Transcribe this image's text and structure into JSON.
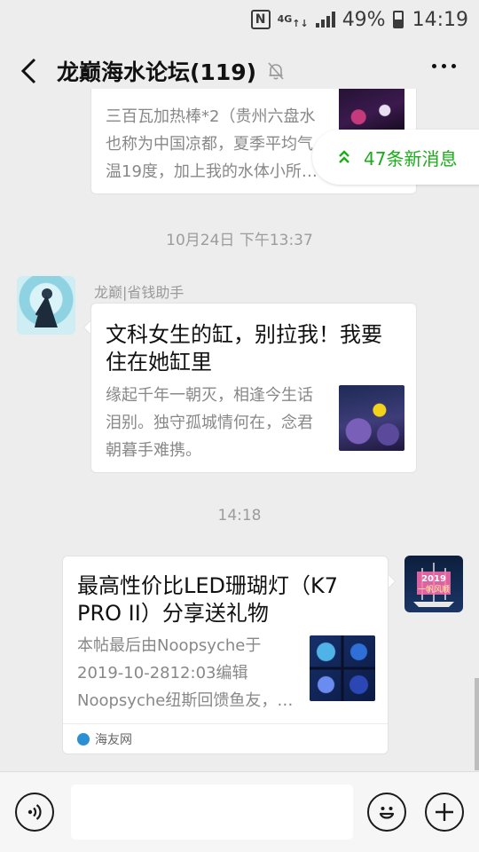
{
  "status_bar": {
    "nfc": "N",
    "network": "4G",
    "battery": "49%",
    "time": "14:19"
  },
  "header": {
    "title": "龙巅海水论坛(119)"
  },
  "new_messages_pill": "47条新消息",
  "messages": [
    {
      "type": "link_card",
      "desc": "三百瓦加热棒*2（贵州六盘水也称为中国凉都，夏季平均气温19度，加上我的水体小所…"
    },
    {
      "type": "timestamp",
      "text": "10月24日 下午13:37"
    },
    {
      "type": "link_card",
      "sender": "龙巅|省钱助手",
      "title": "文科女生的缸，别拉我！我要住在她缸里",
      "desc": "缘起千年一朝灭，相逢今生话泪别。独守孤城情何在，念君朝暮手难携。"
    },
    {
      "type": "timestamp",
      "text": "14:18"
    },
    {
      "type": "link_card",
      "title": "最高性价比LED珊瑚灯（K7 PRO II）分享送礼物",
      "desc": "本帖最后由Noopsyche于2019-10-2812:03编辑Noopsyche纽斯回馈鱼友，…",
      "source": "海友网"
    }
  ],
  "input_bar": {
    "value": ""
  },
  "colors": {
    "accent_green": "#1aad19",
    "background": "#ededed"
  }
}
